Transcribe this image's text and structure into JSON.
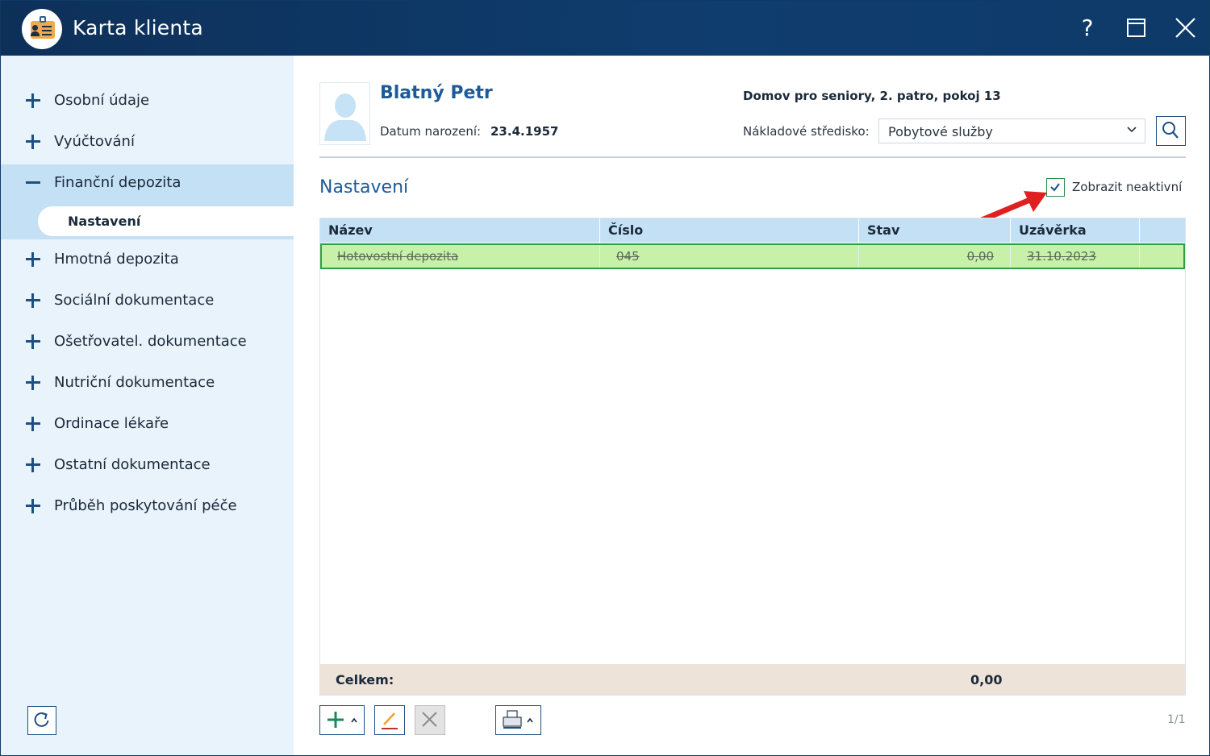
{
  "window": {
    "title": "Karta klienta",
    "help_symbol": "?"
  },
  "sidebar": {
    "items": [
      {
        "label": "Osobní údaje",
        "expanded": false
      },
      {
        "label": "Vyúčtování",
        "expanded": false
      },
      {
        "label": "Finanční depozita",
        "expanded": true
      },
      {
        "label": "Hmotná depozita",
        "expanded": false
      },
      {
        "label": "Sociální dokumentace",
        "expanded": false
      },
      {
        "label": "Ošetřovatel. dokumentace",
        "expanded": false
      },
      {
        "label": "Nutriční dokumentace",
        "expanded": false
      },
      {
        "label": "Ordinace lékaře",
        "expanded": false
      },
      {
        "label": "Ostatní dokumentace",
        "expanded": false
      },
      {
        "label": "Průběh poskytování péče",
        "expanded": false
      }
    ],
    "active_subitem": "Nastavení"
  },
  "client": {
    "name": "Blatný Petr",
    "dob_label": "Datum narození:",
    "dob": "23.4.1957",
    "location": "Domov pro seniory, 2. patro, pokoj 13",
    "cost_center_label": "Nákladové středisko:",
    "cost_center": "Pobytové služby"
  },
  "section": {
    "title": "Nastavení",
    "show_inactive_label": "Zobrazit neaktivní",
    "show_inactive_checked": true
  },
  "table": {
    "columns": [
      "Název",
      "Číslo",
      "Stav",
      "Uzávěrka"
    ],
    "rows": [
      {
        "name": "Hotovostní depozita",
        "number": "045",
        "state": "0,00",
        "closing": "31.10.2023",
        "inactive": true
      }
    ],
    "total_label": "Celkem:",
    "total_value": "0,00"
  },
  "pager": "1/1",
  "colors": {
    "titlebar": "#0f3d6e",
    "accent": "#1d5b96",
    "row_highlight": "#c7f0a8",
    "row_border": "#2ea044",
    "annotation_arrow": "#e02020"
  }
}
